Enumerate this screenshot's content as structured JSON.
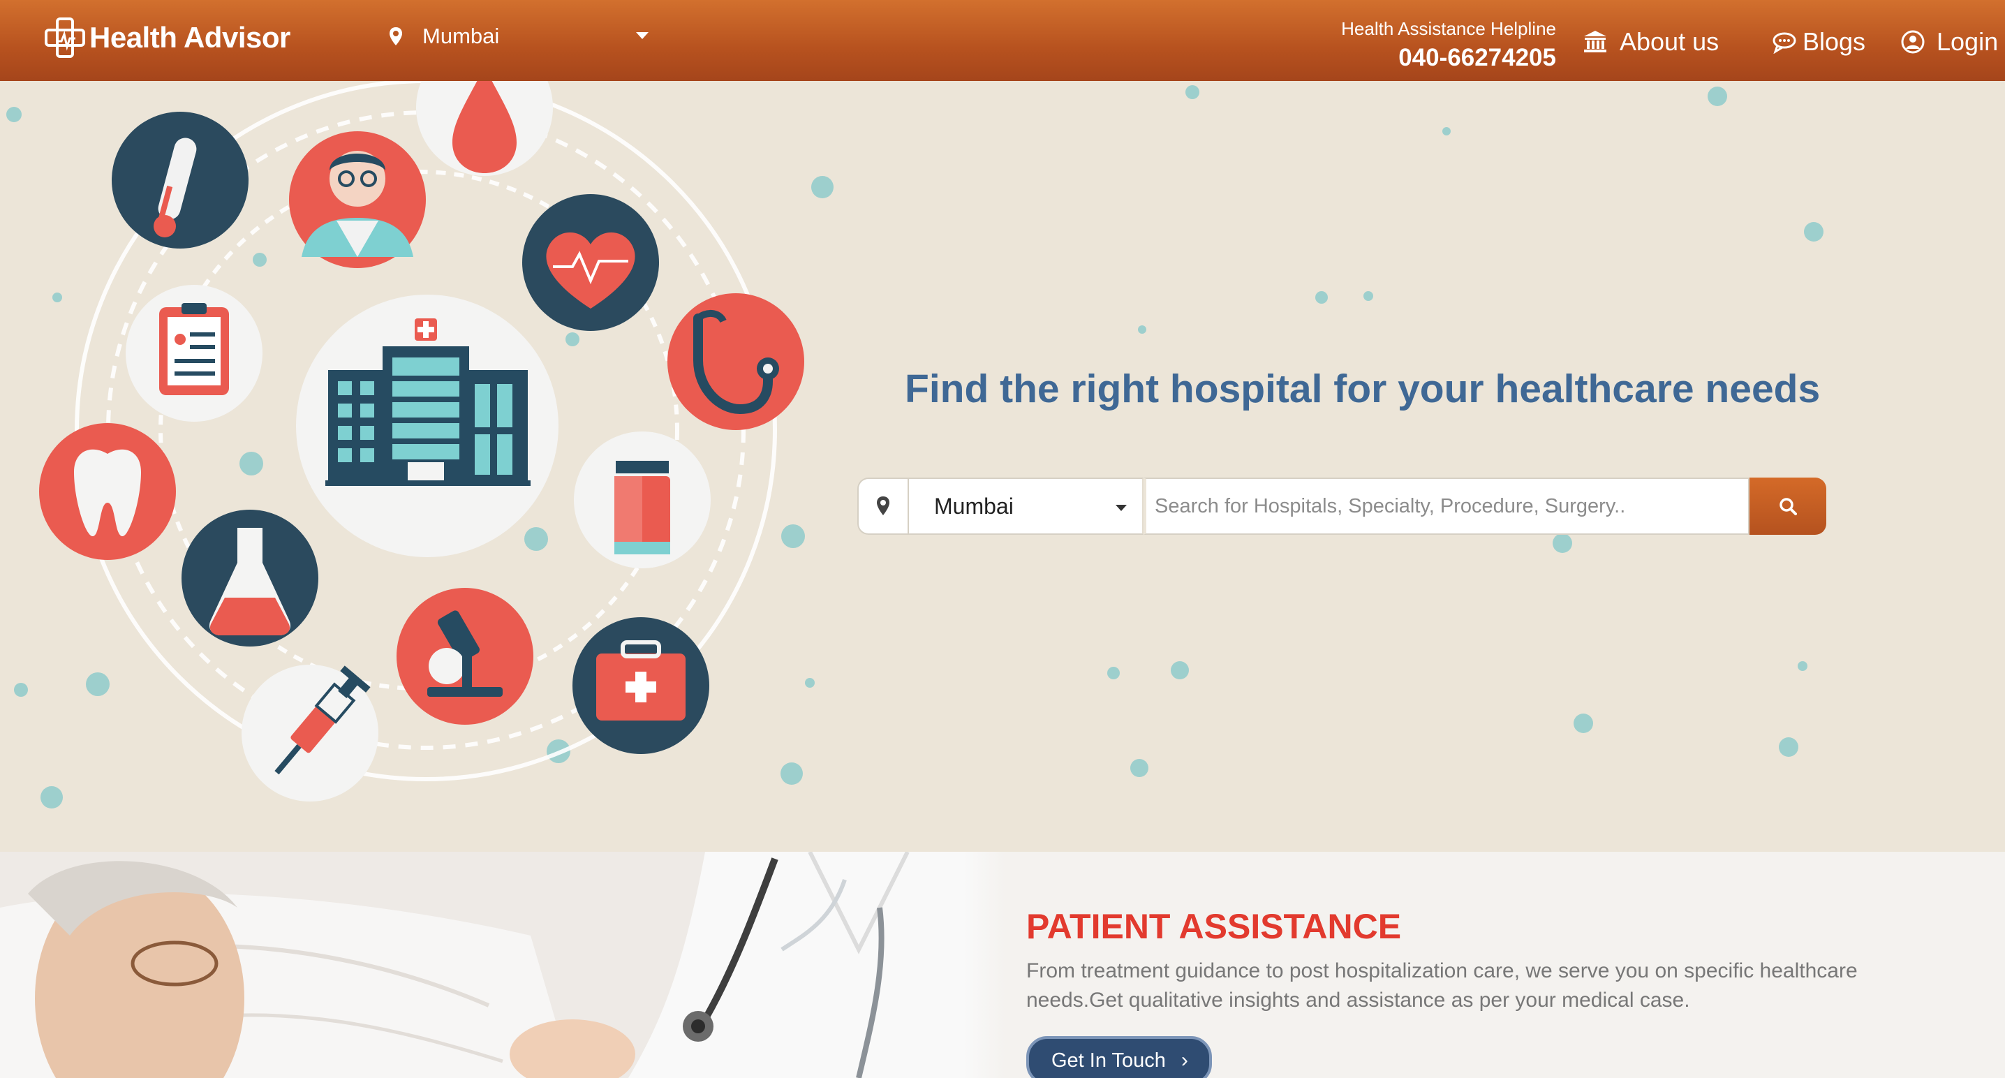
{
  "header": {
    "brand": "Health Advisor",
    "city": "Mumbai",
    "helpline_caption": "Health Assistance Helpline",
    "helpline_number": "040-66274205",
    "nav": {
      "about": "About us",
      "blogs": "Blogs",
      "login": "Login"
    }
  },
  "hero": {
    "title": "Find the right hospital for your healthcare needs",
    "search": {
      "city": "Mumbai",
      "placeholder": "Search for Hospitals, Specialty, Procedure, Surgery.."
    }
  },
  "assistance": {
    "title": "PATIENT ASSISTANCE",
    "description": "From treatment guidance to post hospitalization care, we serve you on specific healthcare needs.Get qualitative insights and assistance as per your medical case.",
    "button": "Get In Touch",
    "button_chevron": "›"
  },
  "colors": {
    "header_orange": "#c05a22",
    "hero_bg": "#ece5d8",
    "title_blue": "#3f6895",
    "accent_red": "#e23a2e",
    "coral": "#ea5b50",
    "navy": "#2b4a5e",
    "teal": "#6cc4c6"
  },
  "icons": [
    "logo-cross-icon",
    "location-pin-icon",
    "bank-icon",
    "chat-bubble-icon",
    "user-circle-icon",
    "search-icon",
    "chevron-right-icon"
  ]
}
